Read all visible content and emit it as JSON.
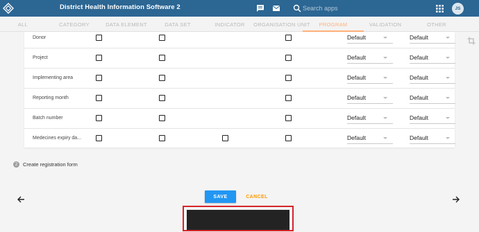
{
  "header": {
    "app_title": "District Health Information Software 2",
    "search_placeholder": "Search apps",
    "user_initials": "JS",
    "bg_color": "#2c6693"
  },
  "tabs": [
    {
      "label": "ALL",
      "active": false
    },
    {
      "label": "CATEGORY",
      "active": false
    },
    {
      "label": "DATA ELEMENT",
      "active": false
    },
    {
      "label": "DATA SET",
      "active": false
    },
    {
      "label": "INDICATOR",
      "active": false
    },
    {
      "label": "ORGANISATION UNIT",
      "active": false
    },
    {
      "label": "PROGRAM",
      "active": true
    },
    {
      "label": "VALIDATION",
      "active": false
    },
    {
      "label": "OTHER",
      "active": false
    }
  ],
  "table": {
    "rows": [
      {
        "label": "Donor",
        "checks": [
          true,
          true,
          false,
          true
        ],
        "select1": "Default",
        "select2": "Default"
      },
      {
        "label": "Project",
        "checks": [
          true,
          true,
          false,
          true
        ],
        "select1": "Default",
        "select2": "Default"
      },
      {
        "label": "Implementing area",
        "checks": [
          true,
          true,
          false,
          true
        ],
        "select1": "Default",
        "select2": "Default"
      },
      {
        "label": "Reporting month",
        "checks": [
          true,
          true,
          false,
          true
        ],
        "select1": "Default",
        "select2": "Default"
      },
      {
        "label": "Batch number",
        "checks": [
          true,
          true,
          false,
          true
        ],
        "select1": "Default",
        "select2": "Default"
      },
      {
        "label": "Medecines expiry da...",
        "checks": [
          true,
          true,
          true,
          true
        ],
        "select1": "Default",
        "select2": "Default"
      }
    ]
  },
  "step": {
    "number": "2",
    "label": "Create registration form"
  },
  "actions": {
    "save_label": "SAVE",
    "cancel_label": "CANCEL"
  },
  "colors": {
    "accent": "#2196f3",
    "cancel": "#ff9800",
    "active_tab": "#ffb07a",
    "highlight": "#d6242a"
  }
}
